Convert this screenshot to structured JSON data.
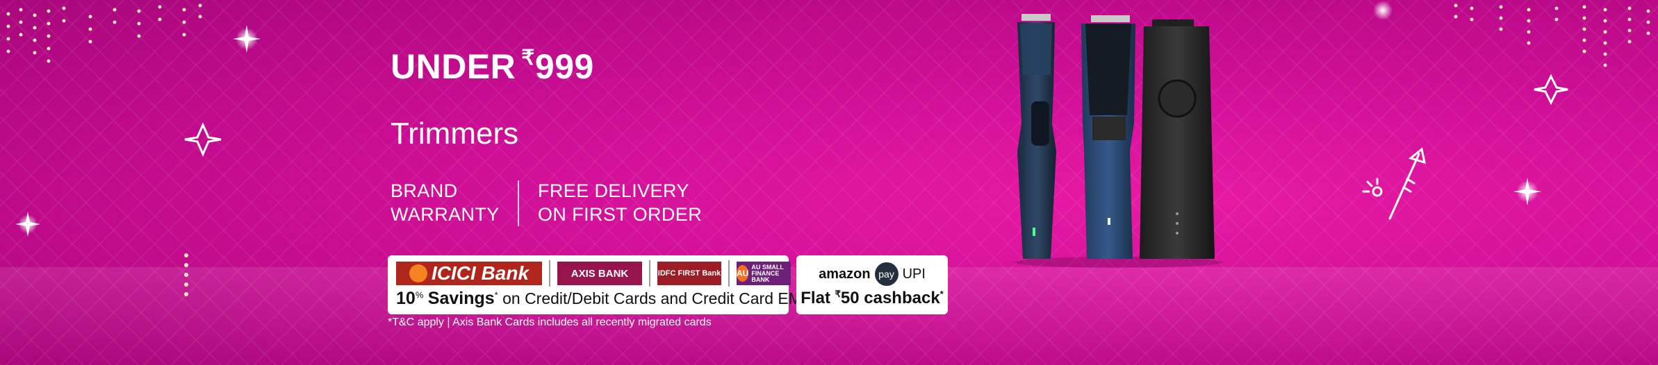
{
  "banner": {
    "headline_prefix": "UNDER",
    "headline_currency": "₹",
    "headline_price": "999",
    "category": "Trimmers",
    "features": [
      {
        "line1": "BRAND",
        "line2": "WARRANTY"
      },
      {
        "line1": "FREE DELIVERY",
        "line2": "ON FIRST ORDER"
      }
    ]
  },
  "bank_offer": {
    "banks": [
      "ICICI Bank",
      "AXIS BANK",
      "IDFC FIRST Bank",
      "AU SMALL FINANCE BANK"
    ],
    "au_short": "AU",
    "percent": "10",
    "percent_sign": "%",
    "savings_word": "Savings",
    "asterisk": "*",
    "rest": " on Credit/Debit Cards and Credit Card EMI*"
  },
  "upi_offer": {
    "brand": "amazon",
    "pay": "pay",
    "upi": "UPI",
    "flat": "Flat ",
    "currency": "₹",
    "amount": "50 cashback",
    "asterisk": "*"
  },
  "tnc": "*T&C apply | Axis Bank Cards includes all recently migrated cards",
  "colors": {
    "background": "#d4109a",
    "icici": "#b0251c",
    "axis": "#97144d",
    "idfc": "#9c1d26",
    "au": "#6d2077"
  },
  "icons": [
    "sparkle-icon",
    "firework-rocket-icon",
    "light-string-icon",
    "trimmer-product-image"
  ]
}
